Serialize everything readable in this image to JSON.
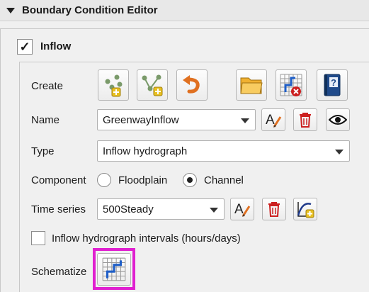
{
  "panel": {
    "title": "Boundary Condition Editor",
    "collapse_icon": "chevron-down-icon"
  },
  "group": {
    "title": "Inflow",
    "checked": true
  },
  "create": {
    "label": "Create",
    "buttons": [
      {
        "name": "add-point-bc-button",
        "icon": "add-points-icon"
      },
      {
        "name": "add-line-bc-button",
        "icon": "add-line-icon"
      },
      {
        "name": "undo-button",
        "icon": "undo-icon"
      },
      {
        "name": "open-button",
        "icon": "folder-icon"
      },
      {
        "name": "delete-schematized-button",
        "icon": "grid-delete-icon"
      },
      {
        "name": "help-button",
        "icon": "help-book-icon"
      }
    ]
  },
  "name_row": {
    "label": "Name",
    "value": "GreenwayInflow"
  },
  "type_row": {
    "label": "Type",
    "value": "Inflow hydrograph"
  },
  "component_row": {
    "label": "Component",
    "options": [
      "Floodplain",
      "Channel"
    ],
    "selected": "Channel"
  },
  "timeseries_row": {
    "label": "Time series",
    "value": "500Steady"
  },
  "intervals": {
    "label": "Inflow hydrograph intervals (hours/days)",
    "checked": false
  },
  "schematize": {
    "label": "Schematize"
  },
  "colors": {
    "highlight": "#e020d0",
    "delete_red": "#cc2020",
    "accent_blue": "#1f5fc8"
  }
}
